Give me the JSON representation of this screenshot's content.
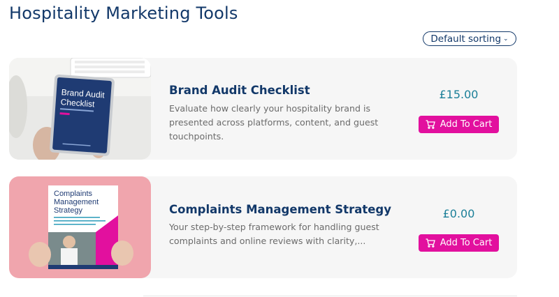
{
  "page": {
    "title": "Hospitality Marketing Tools"
  },
  "sorting": {
    "selected": "Default sorting"
  },
  "products": [
    {
      "title": "Brand Audit Checklist",
      "description": "Evaluate how clearly your hospitality brand is presented across platforms, content, and guest touchpoints.",
      "price": "£15.00",
      "button": "Add To Cart",
      "cover": {
        "line1": "Brand Audit",
        "line2": "Checklist"
      }
    },
    {
      "title": "Complaints Management Strategy",
      "description": "Your step-by-step framework for handling guest complaints and online reviews with clarity,...",
      "price": "£0.00",
      "button": "Add To Cart",
      "cover": {
        "line1": "Complaints",
        "line2": "Management",
        "line3": "Strategy"
      }
    }
  ],
  "colors": {
    "primary": "#123869",
    "accent": "#e2109e",
    "price": "#1b7f98",
    "card_bg": "#f6f6f6"
  }
}
